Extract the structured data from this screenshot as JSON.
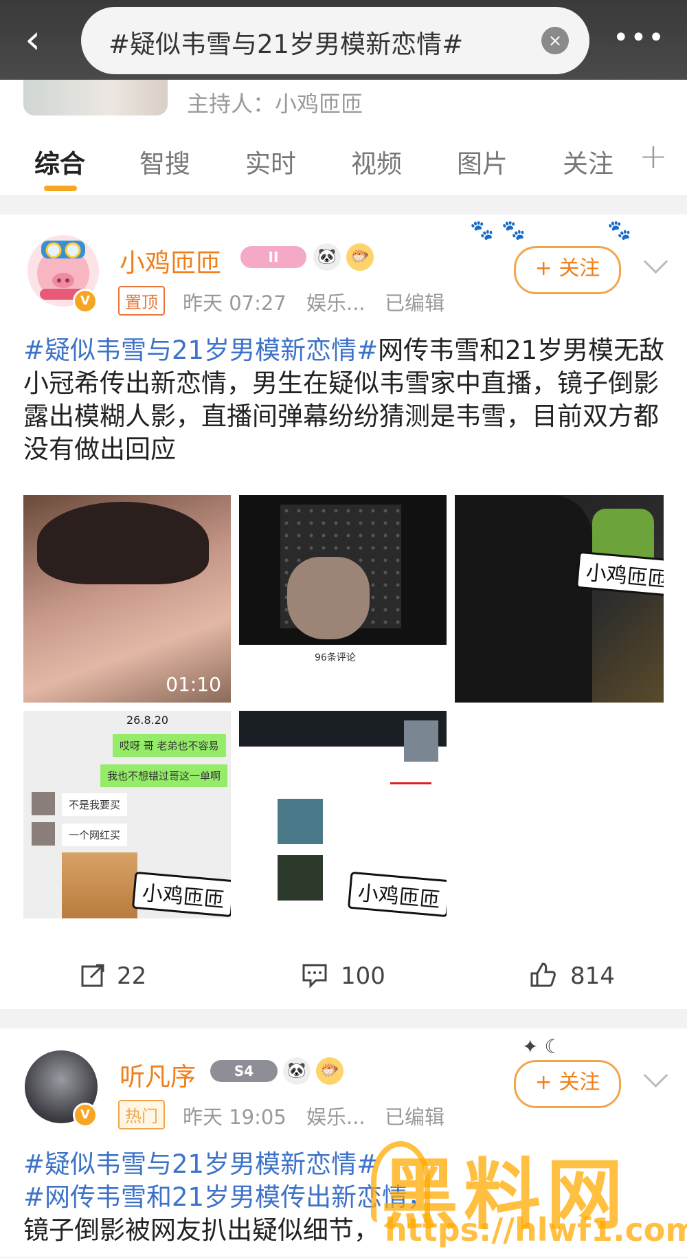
{
  "search": {
    "query": "#疑似韦雪与21岁男模新恋情#",
    "back_glyph": "‹",
    "clear_glyph": "×",
    "more_glyph": "•••"
  },
  "host": {
    "label": "主持人：小鸡匝匝"
  },
  "tabs": [
    {
      "label": "综合",
      "active": true
    },
    {
      "label": "智搜"
    },
    {
      "label": "实时"
    },
    {
      "label": "视频"
    },
    {
      "label": "图片"
    },
    {
      "label": "关注"
    }
  ],
  "tab_add_glyph": "+",
  "posts": [
    {
      "username": "小鸡匝匝",
      "level_badge": "II",
      "badge": "置顶",
      "time": "昨天 07:27",
      "source": "娱乐...",
      "edited": "已编辑",
      "follow_label": "+ 关注",
      "hashtag": "#疑似韦雪与21岁男模新恋情#",
      "text": "网传韦雪和21岁男模无敌小冠希传出新恋情，男生在疑似韦雪家中直播，镜子倒影露出模糊人影，直播间弹幕纷纷猜测是韦雪，目前双方都没有做出回应",
      "video_duration": "01:10",
      "image_watermark": "小鸡匝匝",
      "shares": "22",
      "comments": "100",
      "likes": "814"
    },
    {
      "username": "听凡序",
      "level_badge": "S4",
      "badge": "热门",
      "time": "昨天 19:05",
      "source": "娱乐...",
      "edited": "已编辑",
      "follow_label": "+ 关注",
      "hashtag": "#疑似韦雪与21岁男模新恋情#",
      "text_partial_1": "#网传韦雪和21岁男模传出新恋情，",
      "text_partial_2": "镜子倒影被网友扒出疑似细节，"
    }
  ],
  "chat_screenshot": {
    "date": "26.8.20",
    "msgs": [
      "哎呀 哥 老弟也不容易",
      "我也不想错过哥这一单啊",
      "不是我要买",
      "一个网红买"
    ]
  },
  "live_screenshot": {
    "comment_count": "96条评论"
  },
  "site_watermark": {
    "name": "黑料网",
    "url": "https://hlwf1.com"
  },
  "colors": {
    "accent": "#f07f1a",
    "hashtag": "#3d72c9",
    "tab_underline": "#f5a623"
  }
}
